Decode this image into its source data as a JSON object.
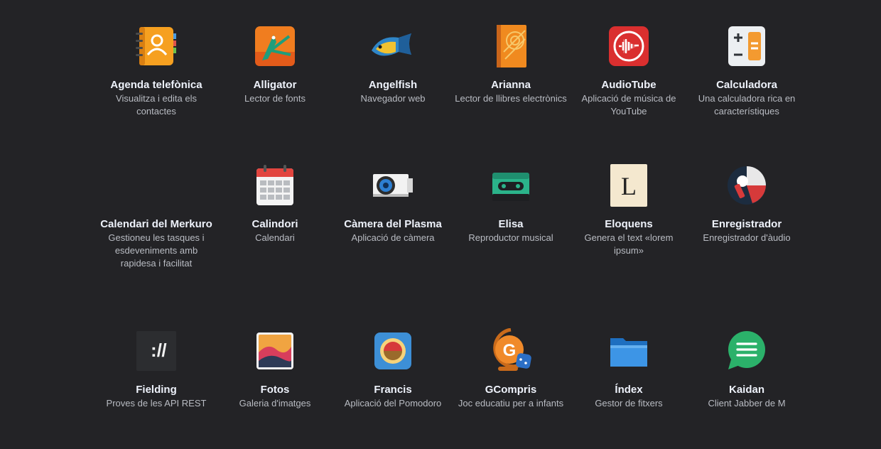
{
  "apps": [
    {
      "name": "Agenda telefònica",
      "desc": "Visualitza i edita els contactes",
      "icon": "address-book-icon"
    },
    {
      "name": "Alligator",
      "desc": "Lector de fonts",
      "icon": "alligator-icon"
    },
    {
      "name": "Angelfish",
      "desc": "Navegador web",
      "icon": "angelfish-icon"
    },
    {
      "name": "Arianna",
      "desc": "Lector de llibres electrònics",
      "icon": "ebook-icon"
    },
    {
      "name": "AudioTube",
      "desc": "Aplicació de música de YouTube",
      "icon": "audiotube-icon"
    },
    {
      "name": "Calculadora",
      "desc": "Una calculadora rica en característiques",
      "icon": "calculator-icon"
    },
    {
      "name": "Calendari del Merkuro",
      "desc": "Gestioneu les tasques i esdeveniments amb rapidesa i facilitat",
      "icon": "merkuro-calendar-icon"
    },
    {
      "name": "Calindori",
      "desc": "Calendari",
      "icon": "calendar-icon"
    },
    {
      "name": "Càmera del Plasma",
      "desc": "Aplicació de càmera",
      "icon": "camera-icon"
    },
    {
      "name": "Elisa",
      "desc": "Reproductor musical",
      "icon": "cassette-icon"
    },
    {
      "name": "Eloquens",
      "desc": "Genera el text «lorem ipsum»",
      "icon": "eloquens-icon"
    },
    {
      "name": "Enregistrador",
      "desc": "Enregistrador d'àudio",
      "icon": "microphone-icon"
    },
    {
      "name": "Fielding",
      "desc": "Proves de les API REST",
      "icon": "terminal-icon"
    },
    {
      "name": "Fotos",
      "desc": "Galeria d'imatges",
      "icon": "photos-icon"
    },
    {
      "name": "Francis",
      "desc": "Aplicació del Pomodoro",
      "icon": "pomodoro-icon"
    },
    {
      "name": "GCompris",
      "desc": "Joc educatiu per a infants",
      "icon": "gcompris-icon"
    },
    {
      "name": "Índex",
      "desc": "Gestor de fitxers",
      "icon": "folder-icon"
    },
    {
      "name": "Kaidan",
      "desc": "Client Jabber de M",
      "icon": "chat-icon"
    }
  ],
  "colors": {
    "background": "#232326",
    "title": "#eef2fb",
    "description": "#b9bcc3"
  }
}
